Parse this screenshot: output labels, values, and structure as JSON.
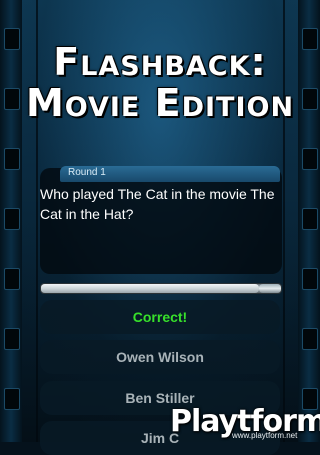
{
  "title": {
    "line1": "Flashback:",
    "line2": "Movie Edition"
  },
  "round_label": "Round 1",
  "question": "Who played The Cat in the movie The Cat in the Hat?",
  "timer_progress": 0.91,
  "answers": [
    {
      "label": "Correct!",
      "state": "correct"
    },
    {
      "label": "Owen Wilson",
      "state": "normal"
    },
    {
      "label": "Ben Stiller",
      "state": "normal"
    },
    {
      "label": "Jim C",
      "state": "normal"
    }
  ],
  "watermark": {
    "brand": "Playtform",
    "url": "www.playtform.net"
  },
  "colors": {
    "correct": "#37e02b",
    "accent": "#2a6b95"
  }
}
